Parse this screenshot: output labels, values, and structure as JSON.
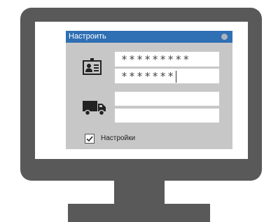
{
  "dialog": {
    "title": "Настроить",
    "login_field_value": "*********",
    "password_field_value": "*******",
    "delivery_field_1_value": "",
    "delivery_field_2_value": "",
    "settings_checkbox_label": "Настройки",
    "settings_checked": true
  },
  "icons": {
    "identity": "id-card-icon",
    "delivery": "delivery-truck-icon",
    "close": "close-dot-icon",
    "checkmark": "checkmark-icon"
  },
  "colors": {
    "titlebar": "#2f6fb4",
    "dialog_bg": "#c7c7c7",
    "monitor": "#595959"
  }
}
